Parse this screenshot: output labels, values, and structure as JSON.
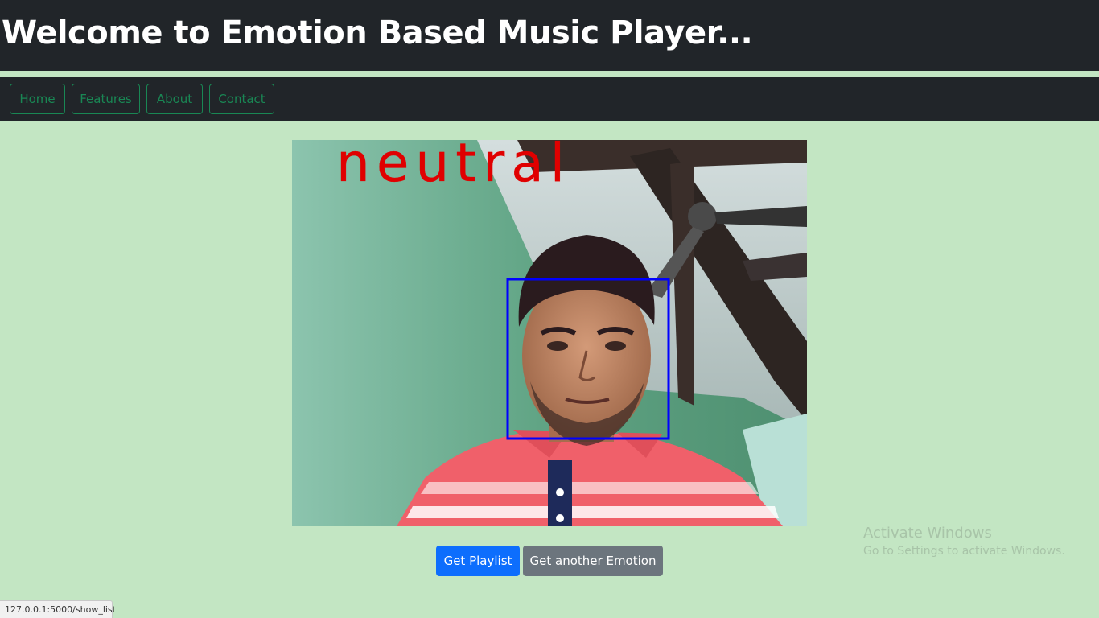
{
  "header": {
    "title": "Welcome to Emotion Based Music Player..."
  },
  "nav": {
    "items": [
      {
        "label": "Home"
      },
      {
        "label": "Features"
      },
      {
        "label": "About"
      },
      {
        "label": "Contact"
      }
    ]
  },
  "camera": {
    "emotion_label": "neutral"
  },
  "actions": {
    "playlist_label": "Get Playlist",
    "another_label": "Get another Emotion"
  },
  "watermark": {
    "title": "Activate Windows",
    "subtitle": "Go to Settings to activate Windows."
  },
  "status": {
    "url": "127.0.0.1:5000/show_list"
  },
  "colors": {
    "header_bg": "#212529",
    "page_bg": "#c3e6c3",
    "nav_outline": "#198754",
    "primary": "#0d6efd",
    "secondary": "#6c757d",
    "emotion_text": "#e00000",
    "face_box": "#0000ff"
  }
}
